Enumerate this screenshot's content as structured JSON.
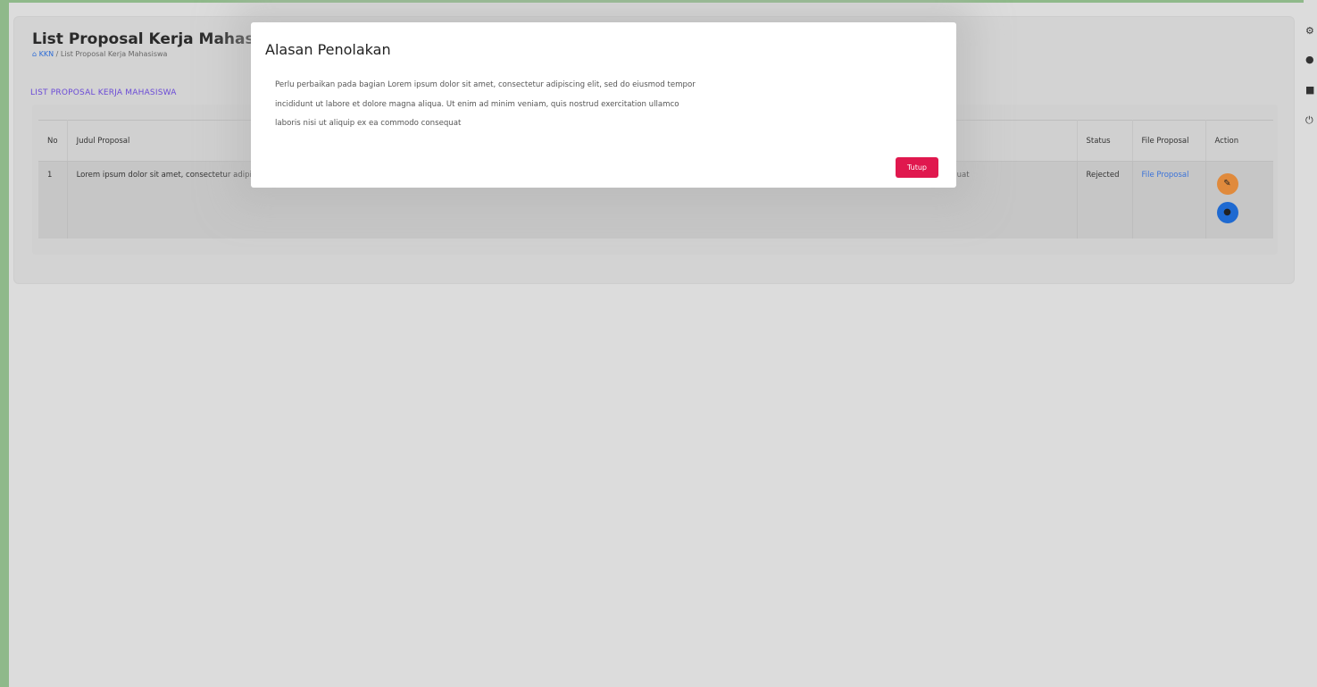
{
  "page": {
    "title": "List Proposal Kerja Mahasiswa",
    "breadcrumb_home": "KKN",
    "breadcrumb_current": "List Proposal Kerja Mahasiswa",
    "section_label": "LIST PROPOSAL KERJA MAHASISWA"
  },
  "table": {
    "headers": {
      "no": "No",
      "title": "Judul Proposal",
      "status": "Status",
      "file": "File Proposal",
      "action": "Action"
    },
    "rows": [
      {
        "no": "1",
        "title": "Lorem ipsum dolor sit amet, consectetur adipiscing elit, sed do eiusmod tempor incididunt ut labore et dolore magna aliqua. Ut enim ad minim veniam, quis nostrud exercitation ullamco laboris nisi ut aliquip ex ea commodo consequat",
        "status": "Rejected",
        "file_link": "File Proposal"
      }
    ]
  },
  "modal": {
    "title": "Alasan Penolakan",
    "body": "Perlu perbaikan pada bagian Lorem ipsum dolor sit amet, consectetur adipiscing elit, sed do eiusmod tempor incididunt ut labore et dolore magna aliqua. Ut enim ad minim veniam, quis nostrud exercitation ullamco laboris nisi ut aliquip ex ea commodo consequat",
    "close_label": "Tutup"
  },
  "icons": {
    "home": "home-icon",
    "edit": "pencil-icon",
    "view": "eye-icon",
    "settings": "gear-icon",
    "user": "user-icon",
    "lock": "lock-icon",
    "power": "power-icon"
  },
  "colors": {
    "close_button": "#e0184e",
    "edit_button": "#e08a3c",
    "view_button": "#1f6ad1",
    "link": "#3b73d9",
    "section_label": "#6b4bd6"
  }
}
